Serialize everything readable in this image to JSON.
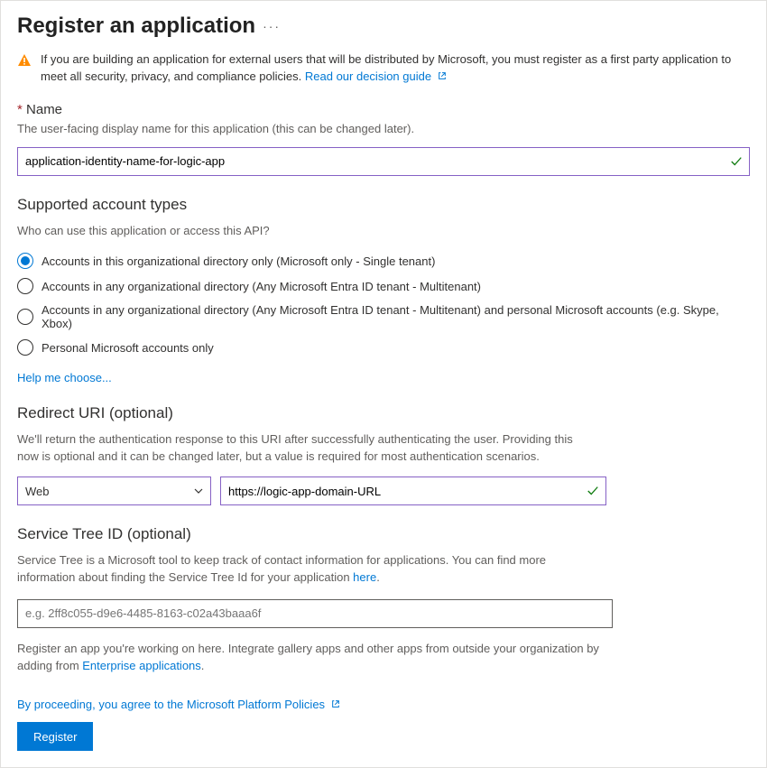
{
  "header": {
    "title": "Register an application"
  },
  "warning": {
    "text": "If you are building an application for external users that will be distributed by Microsoft, you must register as a first party application to meet all security, privacy, and compliance policies. ",
    "link": "Read our decision guide"
  },
  "name_section": {
    "label": "Name",
    "help": "The user-facing display name for this application (this can be changed later).",
    "value": "application-identity-name-for-logic-app"
  },
  "account_types": {
    "heading": "Supported account types",
    "question": "Who can use this application or access this API?",
    "options": [
      "Accounts in this organizational directory only (Microsoft only - Single tenant)",
      "Accounts in any organizational directory (Any Microsoft Entra ID tenant - Multitenant)",
      "Accounts in any organizational directory (Any Microsoft Entra ID tenant - Multitenant) and personal Microsoft accounts (e.g. Skype, Xbox)",
      "Personal Microsoft accounts only"
    ],
    "selected_index": 0,
    "help_link": "Help me choose..."
  },
  "redirect": {
    "heading": "Redirect URI (optional)",
    "help": "We'll return the authentication response to this URI after successfully authenticating the user. Providing this now is optional and it can be changed later, but a value is required for most authentication scenarios.",
    "platform_selected": "Web",
    "url_value": "https://logic-app-domain-URL"
  },
  "service_tree": {
    "heading": "Service Tree ID (optional)",
    "help_prefix": "Service Tree is a Microsoft tool to keep track of contact information for applications. You can find more information about finding the Service Tree Id for your application ",
    "help_link": "here",
    "placeholder": "e.g. 2ff8c055-d9e6-4485-8163-c02a43baaa6f"
  },
  "footer": {
    "note_prefix": "Register an app you're working on here. Integrate gallery apps and other apps from outside your organization by adding from ",
    "note_link": "Enterprise applications",
    "proceed_text": "By proceeding, you agree to the Microsoft Platform Policies",
    "register_label": "Register"
  }
}
